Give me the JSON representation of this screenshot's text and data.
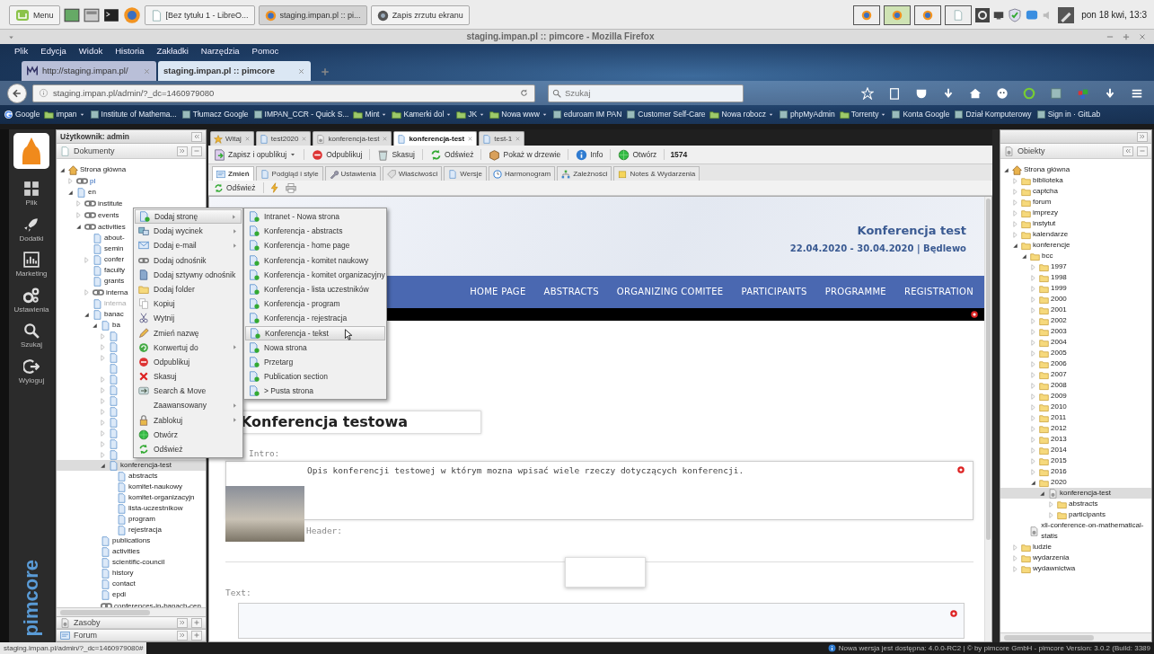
{
  "taskbar": {
    "menu_label": "Menu",
    "windows": [
      {
        "label": "[Bez tytułu 1 - LibreO...",
        "selected": false
      },
      {
        "label": "staging.impan.pl :: pi...",
        "selected": true
      },
      {
        "label": "Zapis zrzutu ekranu",
        "selected": false
      }
    ],
    "workspaces": [
      {
        "selected": false
      },
      {
        "selected": true
      },
      {
        "selected": false
      },
      {
        "selected": false
      }
    ],
    "clock": "pon 18 kwi, 13:3"
  },
  "browser": {
    "title": "staging.impan.pl :: pimcore - Mozilla Firefox",
    "menu": [
      "Plik",
      "Edycja",
      "Widok",
      "Historia",
      "Zakładki",
      "Narzędzia",
      "Pomoc"
    ],
    "tabs": [
      {
        "label": "http://staging.impan.pl/",
        "selected": false
      },
      {
        "label": "staging.impan.pl :: pimcore",
        "selected": true
      }
    ],
    "url": "staging.impan.pl/admin/?_dc=1460979080",
    "search_placeholder": "Szukaj",
    "bookmarks": [
      {
        "label": "Google",
        "kind": "site"
      },
      {
        "label": "impan",
        "kind": "folder"
      },
      {
        "label": "Institute of Mathema...",
        "kind": "site"
      },
      {
        "label": "Tłumacz Google",
        "kind": "site"
      },
      {
        "label": "IMPAN_CCR - Quick S...",
        "kind": "site"
      },
      {
        "label": "Mint",
        "kind": "folder"
      },
      {
        "label": "Kamerki dol",
        "kind": "folder"
      },
      {
        "label": "JK",
        "kind": "folder"
      },
      {
        "label": "Nowa www",
        "kind": "folder"
      },
      {
        "label": "eduroam IM PAN",
        "kind": "site"
      },
      {
        "label": "Customer Self-Care",
        "kind": "site"
      },
      {
        "label": "Nowa robocz",
        "kind": "folder"
      },
      {
        "label": "phpMyAdmin",
        "kind": "site"
      },
      {
        "label": "Torrenty",
        "kind": "folder"
      },
      {
        "label": "Konta Google",
        "kind": "site"
      },
      {
        "label": "Dział Komputerowy",
        "kind": "site"
      },
      {
        "label": "Sign in · GitLab",
        "kind": "site"
      }
    ]
  },
  "sidebar": {
    "items": [
      "Plik",
      "Dodatki",
      "Marketing",
      "Ustawienia",
      "Szukaj",
      "Wyloguj"
    ],
    "logo": "pimcore"
  },
  "documents_panel": {
    "user": "Użytkownik: admin",
    "title": "Dokumenty",
    "tree": [
      {
        "label": "Strona główna",
        "kind": "home",
        "expanded": true,
        "selected": false,
        "children": [
          {
            "label": "pl",
            "kind": "link",
            "expanded": false,
            "selected": false
          },
          {
            "label": "en",
            "kind": "page",
            "expanded": true,
            "selected": false,
            "children": [
              {
                "label": "institute",
                "kind": "link",
                "expanded": false,
                "selected": false
              },
              {
                "label": "events",
                "kind": "link",
                "expanded": false,
                "selected": false
              },
              {
                "label": "activities",
                "kind": "link",
                "expanded": true,
                "selected": false,
                "children": [
                  {
                    "label": "about-",
                    "kind": "page",
                    "selected": false,
                    "unpublished": false
                  },
                  {
                    "label": "semin",
                    "kind": "page",
                    "selected": false,
                    "unpublished": false
                  },
                  {
                    "label": "confer",
                    "kind": "page",
                    "expanded": false,
                    "selected": false,
                    "unpublished": false
                  },
                  {
                    "label": "faculty",
                    "kind": "page",
                    "selected": false,
                    "unpublished": false
                  },
                  {
                    "label": "grants",
                    "kind": "page",
                    "selected": false,
                    "unpublished": false
                  },
                  {
                    "label": "interna",
                    "kind": "link",
                    "expanded": false,
                    "selected": false,
                    "unpublished": false
                  },
                  {
                    "label": "interna",
                    "kind": "page",
                    "selected": false,
                    "unpublished": true
                  },
                  {
                    "label": "banac",
                    "kind": "page",
                    "expanded": true,
                    "selected": false,
                    "unpublished": false,
                    "children": [
                      {
                        "label": "ba",
                        "kind": "page",
                        "expanded": true,
                        "selected": false,
                        "children": [
                          {
                            "kind": "page",
                            "expanded": false,
                            "selected": false
                          },
                          {
                            "kind": "page",
                            "expanded": false,
                            "selected": false
                          },
                          {
                            "kind": "page",
                            "expanded": false,
                            "selected": false
                          },
                          {
                            "kind": "page",
                            "selected": false
                          },
                          {
                            "kind": "page",
                            "expanded": false,
                            "selected": false
                          },
                          {
                            "kind": "page",
                            "expanded": false,
                            "selected": false
                          },
                          {
                            "kind": "page",
                            "expanded": false,
                            "selected": false
                          },
                          {
                            "kind": "page",
                            "expanded": false,
                            "selected": false
                          },
                          {
                            "kind": "page",
                            "expanded": false,
                            "selected": false
                          },
                          {
                            "kind": "page",
                            "expanded": false,
                            "selected": false
                          },
                          {
                            "kind": "page",
                            "expanded": false,
                            "selected": false
                          },
                          {
                            "kind": "page",
                            "expanded": false,
                            "selected": false
                          },
                          {
                            "label": "konferencja-test",
                            "kind": "page",
                            "expanded": true,
                            "selected": true,
                            "children": [
                              {
                                "label": "abstracts",
                                "kind": "page",
                                "selected": false
                              },
                              {
                                "label": "komitet-naukowy",
                                "kind": "page",
                                "selected": false
                              },
                              {
                                "label": "komitet-organizacyjn",
                                "kind": "page",
                                "selected": false
                              },
                              {
                                "label": "lista-uczestnikow",
                                "kind": "page",
                                "selected": false
                              },
                              {
                                "label": "program",
                                "kind": "page",
                                "selected": false
                              },
                              {
                                "label": "rejestracja",
                                "kind": "page",
                                "selected": false
                              }
                            ]
                          }
                        ]
                      },
                      {
                        "label": "publications",
                        "kind": "page",
                        "selected": false
                      },
                      {
                        "label": "activities",
                        "kind": "page",
                        "selected": false
                      },
                      {
                        "label": "scientific-council",
                        "kind": "page",
                        "selected": false
                      },
                      {
                        "label": "history",
                        "kind": "page",
                        "selected": false
                      },
                      {
                        "label": "contact",
                        "kind": "page",
                        "selected": false
                      },
                      {
                        "label": "epdi",
                        "kind": "page",
                        "selected": false
                      },
                      {
                        "label": "conferences-in-banach-cen",
                        "kind": "link",
                        "selected": false
                      }
                    ]
                  }
                ]
              }
            ]
          }
        ]
      }
    ],
    "footer_panels": [
      "Zasoby",
      "Forum"
    ]
  },
  "context_menu": {
    "items": [
      {
        "label": "Dodaj stronę",
        "submenu": true,
        "selected": true
      },
      {
        "label": "Dodaj wycinek",
        "submenu": true,
        "selected": false
      },
      {
        "label": "Dodaj e-mail",
        "submenu": true,
        "selected": false
      },
      {
        "label": "Dodaj odnośnik",
        "submenu": false,
        "selected": false
      },
      {
        "label": "Dodaj sztywny odnośnik",
        "submenu": false,
        "selected": false
      },
      {
        "label": "Dodaj folder",
        "submenu": false,
        "selected": false
      },
      {
        "label": "Kopiuj",
        "submenu": false,
        "selected": false
      },
      {
        "label": "Wytnij",
        "submenu": false,
        "selected": false
      },
      {
        "label": "Zmień nazwę",
        "submenu": false,
        "selected": false
      },
      {
        "label": "Konwertuj do",
        "submenu": true,
        "selected": false
      },
      {
        "label": "Odpublikuj",
        "submenu": false,
        "selected": false
      },
      {
        "label": "Skasuj",
        "submenu": false,
        "selected": false
      },
      {
        "label": "Search & Move",
        "submenu": false,
        "selected": false
      },
      {
        "label": "Zaawansowany",
        "submenu": true,
        "selected": false
      },
      {
        "label": "Zablokuj",
        "submenu": true,
        "selected": false
      },
      {
        "label": "Otwórz",
        "submenu": false,
        "selected": false
      },
      {
        "label": "Odśwież",
        "submenu": false,
        "selected": false
      }
    ],
    "submenu": [
      {
        "label": "Intranet - Nowa strona",
        "selected": false
      },
      {
        "label": "Konferencja - abstracts",
        "selected": false
      },
      {
        "label": "Konferencja - home page",
        "selected": false
      },
      {
        "label": "Konferencja - komitet naukowy",
        "selected": false
      },
      {
        "label": "Konferencja - komitet organizacyjny",
        "selected": false
      },
      {
        "label": "Konferencja - lista uczestników",
        "selected": false
      },
      {
        "label": "Konferencja - program",
        "selected": false
      },
      {
        "label": "Konferencja - rejestracja",
        "selected": false
      },
      {
        "label": "Konferencja - tekst",
        "selected": true
      },
      {
        "label": "Nowa strona",
        "selected": false
      },
      {
        "label": "Przetarg",
        "selected": false
      },
      {
        "label": "Publication section",
        "selected": false
      },
      {
        "label": "> Pusta strona",
        "selected": false
      }
    ]
  },
  "editor": {
    "tabs": [
      {
        "label": "Witaj",
        "selected": false
      },
      {
        "label": "test2020",
        "selected": false
      },
      {
        "label": "konferencja-test",
        "selected": false
      },
      {
        "label": "konferencja-test",
        "selected": true
      },
      {
        "label": "test-1",
        "selected": false
      }
    ],
    "toolbar": [
      {
        "label": "Zapisz i opublikuj",
        "dropdown": true
      },
      {
        "label": "Odpublikuj",
        "dropdown": false
      },
      {
        "label": "Skasuj",
        "dropdown": false
      },
      {
        "label": "Odśwież",
        "dropdown": false
      },
      {
        "label": "Pokaż w drzewie",
        "dropdown": false
      },
      {
        "label": "Info",
        "dropdown": false
      },
      {
        "label": "Otwórz",
        "dropdown": false
      }
    ],
    "document_id": "1574",
    "subtabs": [
      {
        "label": "Zmień",
        "selected": true
      },
      {
        "label": "Podgląd i style",
        "selected": false
      },
      {
        "label": "Ustawienia",
        "selected": false
      },
      {
        "label": "Właściwości",
        "selected": false
      },
      {
        "label": "Wersje",
        "selected": false
      },
      {
        "label": "Harmonogram",
        "selected": false
      },
      {
        "label": "Zależności",
        "selected": false
      },
      {
        "label": "Notes & Wydarzenia",
        "selected": false
      }
    ],
    "refresh_label": "Odśwież",
    "preview": {
      "site_title": "Konferencja test",
      "site_dates": "22.04.2020 - 30.04.2020 | Będlewo",
      "nav": [
        "HOME PAGE",
        "ABSTRACTS",
        "ORGANIZING COMITEE",
        "PARTICIPANTS",
        "PROGRAMME",
        "REGISTRATION"
      ],
      "title_value": "Konferencja testowa",
      "intro_label": "Intro:",
      "intro_text": "Opis konferencji testowej w którym mozna wpisać wiele rzeczy dotyczących konferencji.",
      "header_label": "Header:",
      "text_label": "Text:"
    }
  },
  "objects_panel": {
    "title": "Obiekty",
    "tree": [
      {
        "label": "Strona główna",
        "kind": "home",
        "expanded": true,
        "selected": false,
        "children": [
          {
            "label": "biblioteka",
            "kind": "folder",
            "expanded": false,
            "selected": false
          },
          {
            "label": "captcha",
            "kind": "folder",
            "expanded": false,
            "selected": false
          },
          {
            "label": "forum",
            "kind": "folder",
            "expanded": false,
            "selected": false
          },
          {
            "label": "imprezy",
            "kind": "folder",
            "expanded": false,
            "selected": false
          },
          {
            "label": "instytut",
            "kind": "folder",
            "expanded": false,
            "selected": false
          },
          {
            "label": "kalendarze",
            "kind": "folder",
            "expanded": false,
            "selected": false
          },
          {
            "label": "konferencje",
            "kind": "folder",
            "expanded": true,
            "selected": false,
            "children": [
              {
                "label": "bcc",
                "kind": "folder",
                "expanded": true,
                "selected": false,
                "children": [
                  {
                    "label": "1997",
                    "kind": "folder",
                    "expanded": false,
                    "selected": false
                  },
                  {
                    "label": "1998",
                    "kind": "folder",
                    "expanded": false,
                    "selected": false
                  },
                  {
                    "label": "1999",
                    "kind": "folder",
                    "expanded": false,
                    "selected": false
                  },
                  {
                    "label": "2000",
                    "kind": "folder",
                    "expanded": false,
                    "selected": false
                  },
                  {
                    "label": "2001",
                    "kind": "folder",
                    "expanded": false,
                    "selected": false
                  },
                  {
                    "label": "2002",
                    "kind": "folder",
                    "expanded": false,
                    "selected": false
                  },
                  {
                    "label": "2003",
                    "kind": "folder",
                    "expanded": false,
                    "selected": false
                  },
                  {
                    "label": "2004",
                    "kind": "folder",
                    "expanded": false,
                    "selected": false
                  },
                  {
                    "label": "2005",
                    "kind": "folder",
                    "expanded": false,
                    "selected": false
                  },
                  {
                    "label": "2006",
                    "kind": "folder",
                    "expanded": false,
                    "selected": false
                  },
                  {
                    "label": "2007",
                    "kind": "folder",
                    "expanded": false,
                    "selected": false
                  },
                  {
                    "label": "2008",
                    "kind": "folder",
                    "expanded": false,
                    "selected": false
                  },
                  {
                    "label": "2009",
                    "kind": "folder",
                    "expanded": false,
                    "selected": false
                  },
                  {
                    "label": "2010",
                    "kind": "folder",
                    "expanded": false,
                    "selected": false
                  },
                  {
                    "label": "2011",
                    "kind": "folder",
                    "expanded": false,
                    "selected": false
                  },
                  {
                    "label": "2012",
                    "kind": "folder",
                    "expanded": false,
                    "selected": false
                  },
                  {
                    "label": "2013",
                    "kind": "folder",
                    "expanded": false,
                    "selected": false
                  },
                  {
                    "label": "2014",
                    "kind": "folder",
                    "expanded": false,
                    "selected": false
                  },
                  {
                    "label": "2015",
                    "kind": "folder",
                    "expanded": false,
                    "selected": false
                  },
                  {
                    "label": "2016",
                    "kind": "folder",
                    "expanded": false,
                    "selected": false
                  },
                  {
                    "label": "2020",
                    "kind": "folder",
                    "expanded": true,
                    "selected": false,
                    "children": [
                      {
                        "label": "konferencja-test",
                        "kind": "object",
                        "expanded": true,
                        "selected": true,
                        "children": [
                          {
                            "label": "abstracts",
                            "kind": "folder",
                            "expanded": false,
                            "selected": false
                          },
                          {
                            "label": "participants",
                            "kind": "folder",
                            "expanded": false,
                            "selected": false
                          }
                        ]
                      }
                    ]
                  }
                ]
              },
              {
                "label": "xli-conference-on-mathematical-statis",
                "kind": "object",
                "selected": false
              }
            ]
          },
          {
            "label": "ludzie",
            "kind": "folder",
            "expanded": false,
            "selected": false
          },
          {
            "label": "wydarzenia",
            "kind": "folder",
            "expanded": false,
            "selected": false
          },
          {
            "label": "wydawnictwa",
            "kind": "folder",
            "expanded": false,
            "selected": false
          }
        ]
      }
    ]
  },
  "status_bar": {
    "link_preview": "staging.impan.pl/admin/?_dc=1460979080#",
    "version_notice": "Nowa wersja jest dostępna: 4.0.0-RC2 | © by pimcore GmbH - pimcore Version: 3.0.2 (Build: 3389"
  }
}
